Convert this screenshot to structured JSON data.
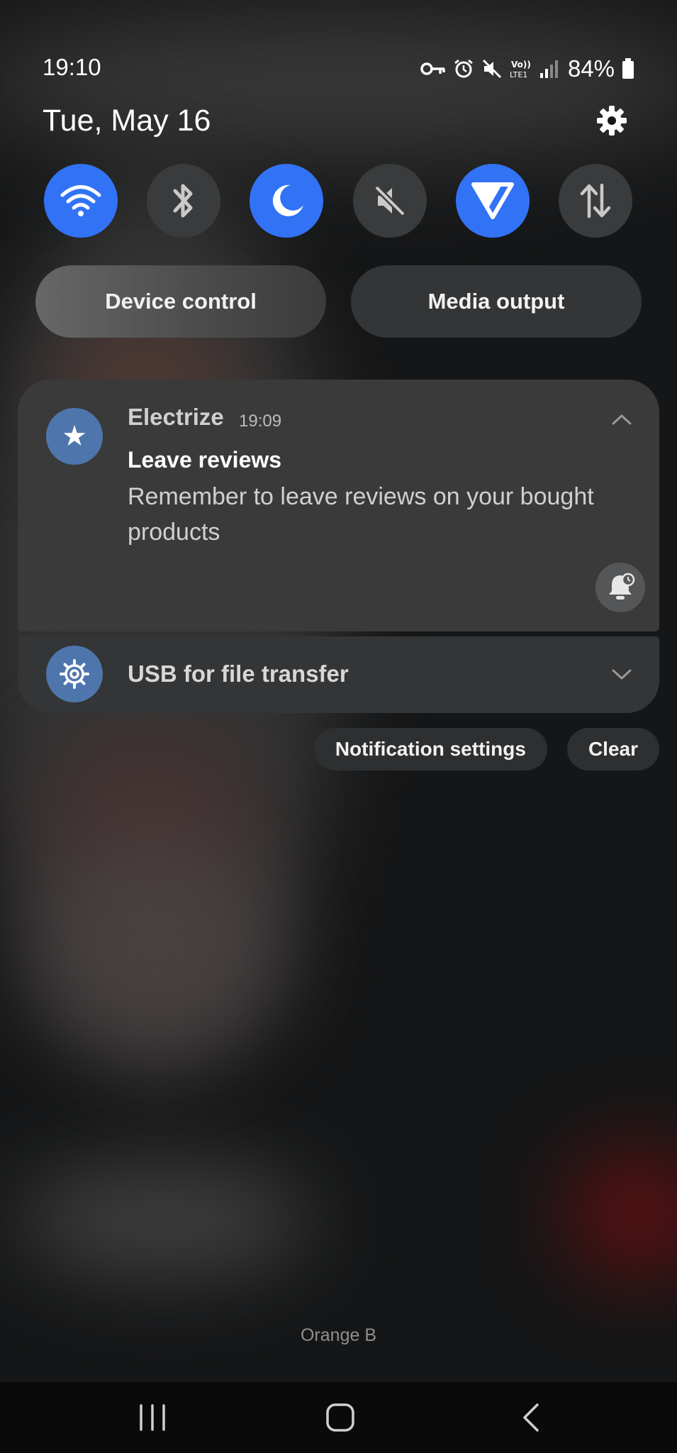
{
  "status_bar": {
    "time": "19:10",
    "battery_percent": "84%",
    "icons": [
      "vpn-key-icon",
      "alarm-icon",
      "mute-icon",
      "volte-icon",
      "signal-icon",
      "battery-icon"
    ],
    "volte_label": "Vo)) LTE1"
  },
  "header": {
    "date": "Tue, May 16",
    "settings_icon": "gear-icon"
  },
  "quick_settings": [
    {
      "name": "wifi",
      "icon": "wifi-icon",
      "state": "on"
    },
    {
      "name": "bluetooth",
      "icon": "bluetooth-icon",
      "state": "off"
    },
    {
      "name": "dark-mode",
      "icon": "moon-icon",
      "state": "on"
    },
    {
      "name": "sound",
      "icon": "mute-icon",
      "state": "off"
    },
    {
      "name": "power-saving",
      "icon": "triangle-icon",
      "state": "on"
    },
    {
      "name": "mobile-data",
      "icon": "data-arrows-icon",
      "state": "off"
    }
  ],
  "pills": {
    "device_control": "Device control",
    "media_output": "Media output"
  },
  "notification": {
    "app_name": "Electrize",
    "time": "19:09",
    "title": "Leave reviews",
    "body": "Remember to leave reviews on your bought products"
  },
  "usb_notification": {
    "label": "USB for file transfer"
  },
  "actions": {
    "notification_settings": "Notification settings",
    "clear": "Clear"
  },
  "carrier": "Orange B",
  "colors": {
    "accent": "#3273f6",
    "app_icon_bg": "#4e76ad",
    "tile_off": "#3a3b3c"
  }
}
